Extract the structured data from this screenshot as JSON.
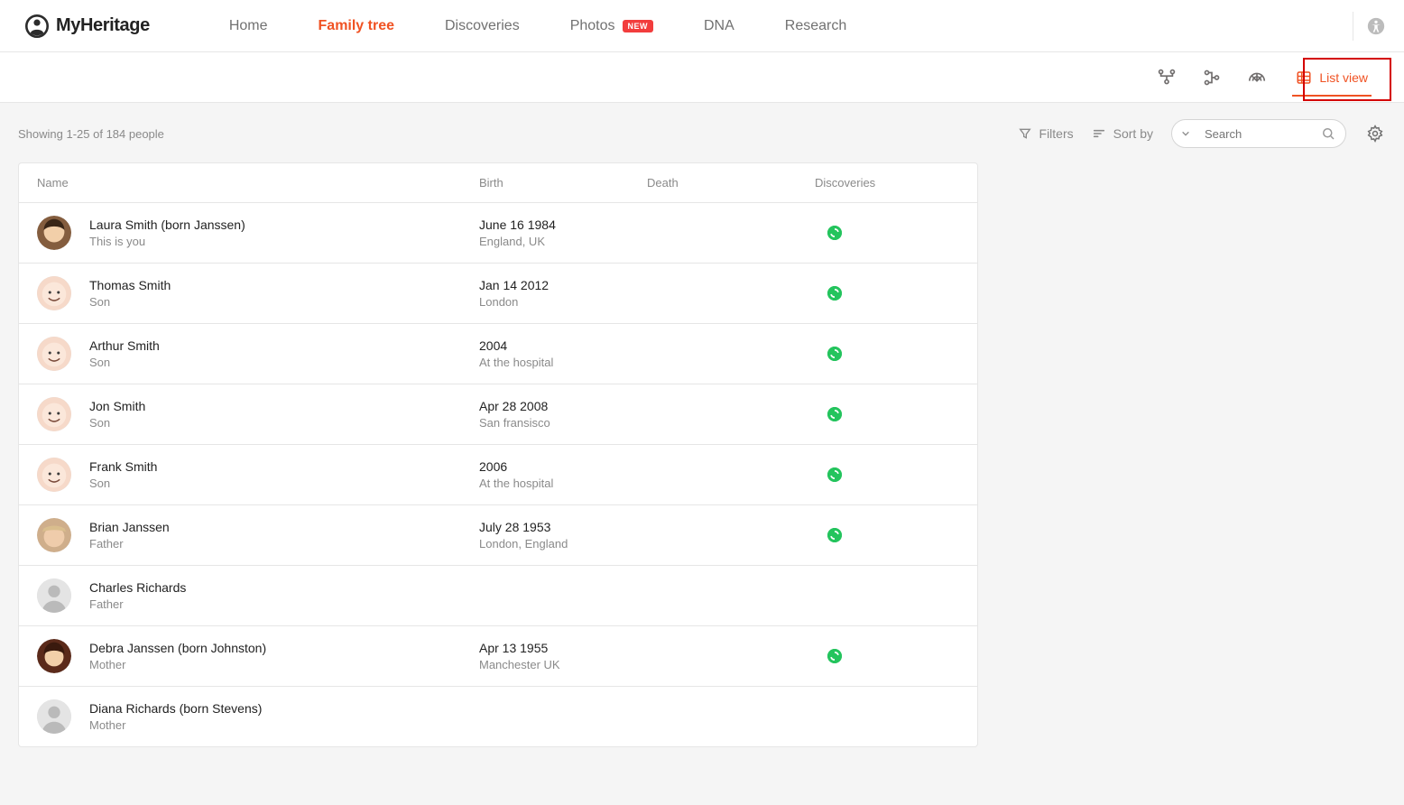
{
  "brand": "MyHeritage",
  "nav": {
    "home": "Home",
    "family_tree": "Family tree",
    "discoveries": "Discoveries",
    "photos": "Photos",
    "photos_badge": "NEW",
    "dna": "DNA",
    "research": "Research"
  },
  "viewbar": {
    "list_view": "List view"
  },
  "toolbar": {
    "showing": "Showing 1-25 of 184 people",
    "filters": "Filters",
    "sortby": "Sort by",
    "search_placeholder": "Search"
  },
  "table": {
    "headers": {
      "name": "Name",
      "birth": "Birth",
      "death": "Death",
      "discoveries": "Discoveries"
    },
    "rows": [
      {
        "avatar": "f1",
        "name": "Laura Smith (born Janssen)",
        "rel": "This is you",
        "birth_line1": "June 16 1984",
        "birth_line2": "England, UK",
        "death": "",
        "discovery": true
      },
      {
        "avatar": "child1",
        "name": "Thomas Smith",
        "rel": "Son",
        "birth_line1": "Jan 14 2012",
        "birth_line2": "London",
        "death": "",
        "discovery": true
      },
      {
        "avatar": "child2",
        "name": "Arthur Smith",
        "rel": "Son",
        "birth_line1": "2004",
        "birth_line2": "At the hospital",
        "death": "",
        "discovery": true
      },
      {
        "avatar": "child3",
        "name": "Jon Smith",
        "rel": "Son",
        "birth_line1": "Apr 28 2008",
        "birth_line2": "San fransisco",
        "death": "",
        "discovery": true
      },
      {
        "avatar": "child4",
        "name": "Frank Smith",
        "rel": "Son",
        "birth_line1": "2006",
        "birth_line2": "At the hospital",
        "death": "",
        "discovery": true
      },
      {
        "avatar": "m1",
        "name": "Brian Janssen",
        "rel": "Father",
        "birth_line1": "July 28 1953",
        "birth_line2": "London, England",
        "death": "",
        "discovery": true
      },
      {
        "avatar": "none",
        "name": "Charles Richards",
        "rel": "Father",
        "birth_line1": "",
        "birth_line2": "",
        "death": "",
        "discovery": false
      },
      {
        "avatar": "f2",
        "name": "Debra Janssen (born Johnston)",
        "rel": "Mother",
        "birth_line1": "Apr 13 1955",
        "birth_line2": "Manchester UK",
        "death": "",
        "discovery": true
      },
      {
        "avatar": "none",
        "name": "Diana Richards (born Stevens)",
        "rel": "Mother",
        "birth_line1": "",
        "birth_line2": "",
        "death": "",
        "discovery": false
      }
    ]
  },
  "colors": {
    "accent": "#f05223",
    "green": "#24c45d",
    "highlight": "#d40000"
  }
}
